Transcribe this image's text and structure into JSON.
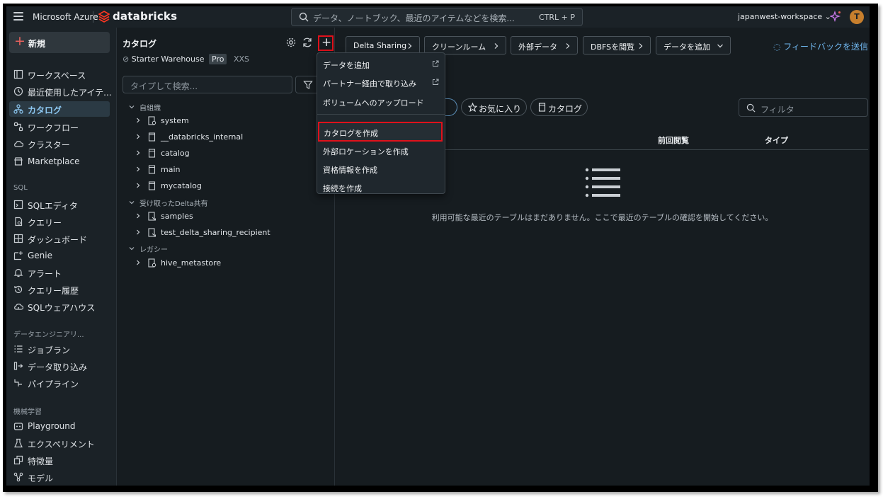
{
  "topbar": {
    "brand_azure": "Microsoft Azure",
    "brand_databricks": "databricks",
    "search_placeholder": "データ、ノートブック、最近のアイテムなどを検索...",
    "search_shortcut": "CTRL + P",
    "workspace": "japanwest-workspace",
    "avatar_initial": "T"
  },
  "sidebar": {
    "new_label": "新規",
    "items_top": [
      "ワークスペース",
      "最近使用したアイテ...",
      "カタログ",
      "ワークフロー",
      "クラスター",
      "Marketplace"
    ],
    "sql_header": "SQL",
    "items_sql": [
      "SQLエディタ",
      "クエリー",
      "ダッシュボード",
      "Genie",
      "アラート",
      "クエリー履歴",
      "SQLウェアハウス"
    ],
    "de_header": "データエンジニアリ...",
    "items_de": [
      "ジョブラン",
      "データ取り込み",
      "パイプライン"
    ],
    "ml_header": "機械学習",
    "items_ml": [
      "Playground",
      "エクスペリメント",
      "特徴量",
      "モデル"
    ]
  },
  "catalog_panel": {
    "title": "カタログ",
    "warehouse_name": "Starter Warehouse",
    "warehouse_tier": "Pro",
    "warehouse_size": "XXS",
    "search_placeholder": "タイプして検索...",
    "group_org": "自組織",
    "org_items": [
      "system",
      "__databricks_internal",
      "catalog",
      "main",
      "mycatalog"
    ],
    "group_shared": "受け取ったDelta共有",
    "shared_items": [
      "samples",
      "test_delta_sharing_recipient"
    ],
    "group_legacy": "レガシー",
    "legacy_items": [
      "hive_metastore"
    ]
  },
  "main": {
    "chips": [
      "Delta Sharing",
      "クリーンルーム",
      "外部データ",
      "DBFSを閲覧",
      "データを追加"
    ],
    "feedback": "フィードバックを送信",
    "pill_favorites": "お気に入り",
    "pill_catalog": "カタログ",
    "filter_placeholder": "フィルタ",
    "col_last_viewed": "前回閲覧",
    "col_type": "タイプ",
    "empty_message": "利用可能な最近のテーブルはまだありません。ここで最近のテーブルの確認を開始してください。"
  },
  "dropdown": {
    "items": [
      "データを追加",
      "パートナー経由で取り込み",
      "ボリュームへのアップロード",
      "カタログを作成",
      "外部ロケーションを作成",
      "資格情報を作成",
      "接続を作成"
    ]
  },
  "colors": {
    "highlight": "#e0111b",
    "accent": "#8ec9f3",
    "link": "#6fb6ee"
  }
}
